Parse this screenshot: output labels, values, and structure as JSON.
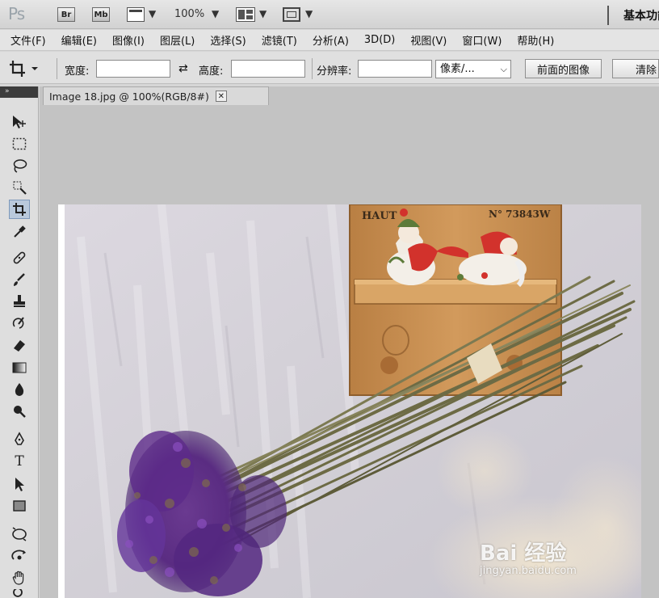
{
  "appbar": {
    "logo": "Ps",
    "bridge": "Br",
    "mini_bridge": "Mb",
    "zoom": "100%",
    "workspace": "基本功能"
  },
  "menu": [
    "文件(F)",
    "编辑(E)",
    "图像(I)",
    "图层(L)",
    "选择(S)",
    "滤镜(T)",
    "分析(A)",
    "3D(D)",
    "视图(V)",
    "窗口(W)",
    "帮助(H)"
  ],
  "options": {
    "width_label": "宽度:",
    "width_value": "",
    "height_label": "高度:",
    "height_value": "",
    "resolution_label": "分辨率:",
    "resolution_value": "",
    "unit_select": "像素/...",
    "front_image_button": "前面的图像",
    "clear_button": "清除"
  },
  "document": {
    "tab_title": "Image 18.jpg @ 100%(RGB/8#)"
  },
  "photo": {
    "sign_left": "HAUT",
    "sign_right": "N° 73843W"
  },
  "watermark": {
    "main": "Bai 经验",
    "sub": "jingyan.baidu.com"
  },
  "colors": {
    "active_tool": "#b9c9dc",
    "lavender": "#5d2b8a",
    "stems": "#6d6b45",
    "shelf": "#c8904e"
  }
}
